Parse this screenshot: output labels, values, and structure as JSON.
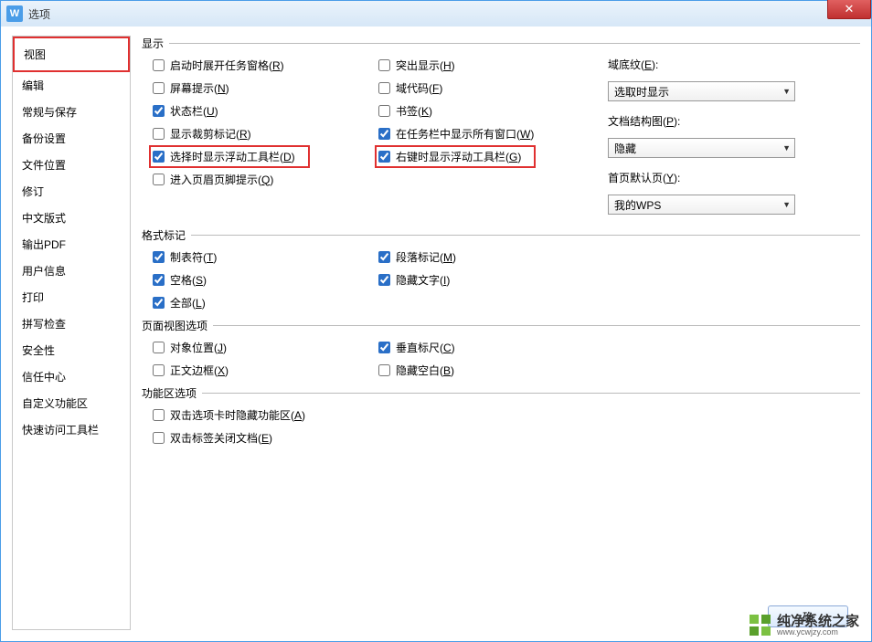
{
  "window": {
    "title": "选项",
    "close": "✕"
  },
  "sidebar": {
    "items": [
      "视图",
      "编辑",
      "常规与保存",
      "备份设置",
      "文件位置",
      "修订",
      "中文版式",
      "输出PDF",
      "用户信息",
      "打印",
      "拼写检查",
      "安全性",
      "信任中心",
      "自定义功能区",
      "快速访问工具栏"
    ]
  },
  "sections": {
    "display": {
      "title": "显示",
      "col1": [
        {
          "label": "启动时展开任务窗格(",
          "u": "R",
          "tail": ")",
          "checked": false
        },
        {
          "label": "屏幕提示(",
          "u": "N",
          "tail": ")",
          "checked": false
        },
        {
          "label": "状态栏(",
          "u": "U",
          "tail": ")",
          "checked": true
        },
        {
          "label": "显示裁剪标记(",
          "u": "R",
          "tail": ")",
          "checked": false
        },
        {
          "label": "选择时显示浮动工具栏(",
          "u": "D",
          "tail": ")",
          "checked": true,
          "hl": true
        },
        {
          "label": "进入页眉页脚提示(",
          "u": "Q",
          "tail": ")",
          "checked": false
        }
      ],
      "col2": [
        {
          "label": "突出显示(",
          "u": "H",
          "tail": ")",
          "checked": false
        },
        {
          "label": "域代码(",
          "u": "F",
          "tail": ")",
          "checked": false
        },
        {
          "label": "书签(",
          "u": "K",
          "tail": ")",
          "checked": false
        },
        {
          "label": "在任务栏中显示所有窗口(",
          "u": "W",
          "tail": ")",
          "checked": true
        },
        {
          "label": "右键时显示浮动工具栏(",
          "u": "G",
          "tail": ")",
          "checked": true,
          "hl": true
        }
      ],
      "col3": [
        {
          "label": "域底纹(",
          "u": "E",
          "tail": "):",
          "value": "选取时显示"
        },
        {
          "label": "文档结构图(",
          "u": "P",
          "tail": "):",
          "value": "隐藏"
        },
        {
          "label": "首页默认页(",
          "u": "Y",
          "tail": "):",
          "value": "我的WPS"
        }
      ]
    },
    "marks": {
      "title": "格式标记",
      "col1": [
        {
          "label": "制表符(",
          "u": "T",
          "tail": ")",
          "checked": true
        },
        {
          "label": "空格(",
          "u": "S",
          "tail": ")",
          "checked": true
        },
        {
          "label": "全部(",
          "u": "L",
          "tail": ")",
          "checked": true
        }
      ],
      "col2": [
        {
          "label": "段落标记(",
          "u": "M",
          "tail": ")",
          "checked": true
        },
        {
          "label": "隐藏文字(",
          "u": "I",
          "tail": ")",
          "checked": true
        }
      ]
    },
    "pageview": {
      "title": "页面视图选项",
      "col1": [
        {
          "label": "对象位置(",
          "u": "J",
          "tail": ")",
          "checked": false
        },
        {
          "label": "正文边框(",
          "u": "X",
          "tail": ")",
          "checked": false
        }
      ],
      "col2": [
        {
          "label": "垂直标尺(",
          "u": "C",
          "tail": ")",
          "checked": true
        },
        {
          "label": "隐藏空白(",
          "u": "B",
          "tail": ")",
          "checked": false
        }
      ]
    },
    "ribbon": {
      "title": "功能区选项",
      "col1": [
        {
          "label": "双击选项卡时隐藏功能区(",
          "u": "A",
          "tail": ")",
          "checked": false
        },
        {
          "label": "双击标签关闭文档(",
          "u": "E",
          "tail": ")",
          "checked": false
        }
      ]
    }
  },
  "buttons": {
    "ok": "确"
  },
  "watermark": {
    "cn": "纯净系统之家",
    "en": "www.ycwjzy.com"
  },
  "app_icon": "W"
}
